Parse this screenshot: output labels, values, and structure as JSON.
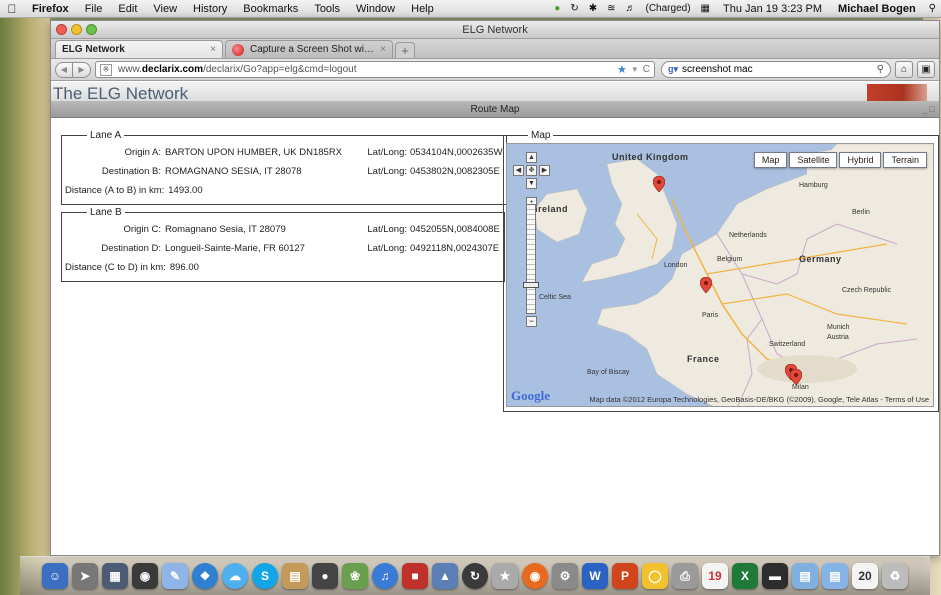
{
  "menubar": {
    "app_name": "Firefox",
    "items": [
      "File",
      "Edit",
      "View",
      "History",
      "Bookmarks",
      "Tools",
      "Window",
      "Help"
    ],
    "battery": "(Charged)",
    "clock": "Thu Jan 19  3:23 PM",
    "user": "Michael Bogen"
  },
  "browser": {
    "window_title": "ELG Network",
    "tabs": [
      {
        "label": "ELG Network",
        "active": true
      },
      {
        "label": "Capture a Screen Shot with Mac...",
        "active": false
      }
    ],
    "url_prefix": "www.",
    "url_domain": "declarix.com",
    "url_path": "/declarix/Go?app=elg&cmd=logout",
    "search_value": "screenshot mac"
  },
  "page": {
    "brand": "The ELG Network",
    "panel_title": "Route Map",
    "lane_a": {
      "legend": "Lane A",
      "origin_label": "Origin A:",
      "origin_value": "BARTON UPON HUMBER, UK DN185RX",
      "origin_latlong_label": "Lat/Long:",
      "origin_latlong": "0534104N,0002635W",
      "dest_label": "Destination B:",
      "dest_value": "ROMAGNANO SESIA, IT 28078",
      "dest_latlong_label": "Lat/Long:",
      "dest_latlong": "0453802N,0082305E",
      "distance_label": "Distance (A to B) in km:",
      "distance_value": "1493.00"
    },
    "lane_b": {
      "legend": "Lane B",
      "origin_label": "Origin C:",
      "origin_value": "Romagnano Sesia, IT 28079",
      "origin_latlong_label": "Lat/Long:",
      "origin_latlong": "0452055N,0084008E",
      "dest_label": "Destination D:",
      "dest_value": "Longueil-Sainte-Marie, FR 60127",
      "dest_latlong_label": "Lat/Long:",
      "dest_latlong": "0492118N,0024307E",
      "distance_label": "Distance (C to D) in km:",
      "distance_value": "896.00"
    },
    "map": {
      "legend": "Map",
      "types": [
        "Map",
        "Satellite",
        "Hybrid",
        "Terrain"
      ],
      "attribution": "Map data ©2012 Europa Technologies, GeoBasis-DE/BKG (©2009), Google, Tele Atlas - Terms of Use",
      "google": "Google",
      "labels": {
        "uk": "United Kingdom",
        "ireland": "Ireland",
        "germany": "Germany",
        "france": "France",
        "netherlands": "Netherlands",
        "belgium": "Belgium",
        "switzerland": "Switzerland",
        "austria": "Austria",
        "czech": "Czech Republic",
        "paris": "Paris",
        "london": "London",
        "hamburg": "Hamburg",
        "berlin": "Berlin",
        "munich": "Munich",
        "milan": "Milan",
        "celtic_sea": "Celtic Sea",
        "bay_of_biscay": "Bay of Biscay"
      }
    }
  },
  "colors": {
    "map_sea": "#aac0e0",
    "map_land": "#eeeae0",
    "marker": "#e2473a"
  }
}
